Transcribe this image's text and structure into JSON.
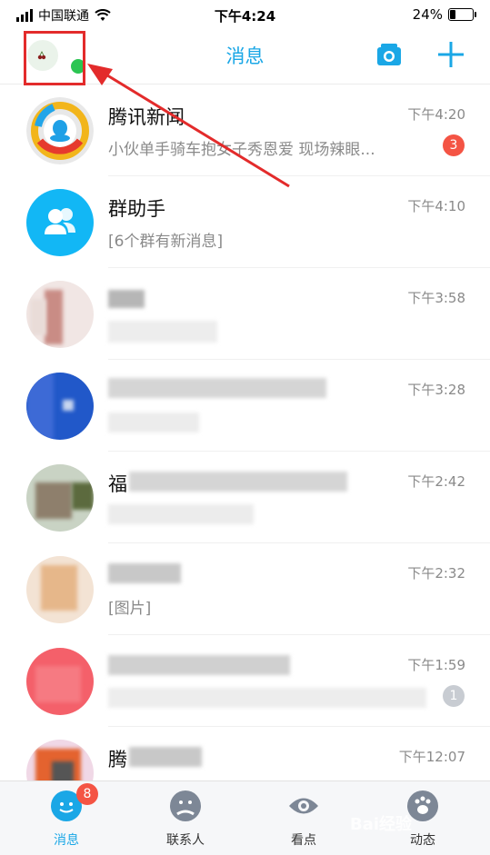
{
  "status_bar": {
    "carrier": "中国联通",
    "time": "下午4:24",
    "battery": "24%",
    "battery_level": 0.24
  },
  "header": {
    "title": "消息"
  },
  "chats": [
    {
      "name": "腾讯新闻",
      "message": "小伙单手骑车抱女子秀恩爱 现场辣眼...",
      "time": "下午4:20",
      "badge": "3"
    },
    {
      "name": "群助手",
      "message": "[6个群有新消息]",
      "time": "下午4:10",
      "badge": ""
    },
    {
      "name": "",
      "message": "",
      "time": "下午3:58",
      "badge": ""
    },
    {
      "name": "",
      "message": "",
      "time": "下午3:28",
      "badge": ""
    },
    {
      "name": "福",
      "message": "",
      "time": "下午2:42",
      "badge": ""
    },
    {
      "name": "",
      "message": "[图片]",
      "time": "下午2:32",
      "badge": ""
    },
    {
      "name": "",
      "message": "",
      "time": "下午1:59",
      "badge": "1"
    },
    {
      "name": "腾",
      "message": "",
      "time": "下午12:07",
      "badge": ""
    }
  ],
  "tabbar": {
    "tabs": [
      {
        "label": "消息",
        "badge": "8"
      },
      {
        "label": "联系人"
      },
      {
        "label": "看点"
      },
      {
        "label": "动态"
      }
    ]
  },
  "watermark": "Bai经验",
  "colors": {
    "accent": "#1aa7e6",
    "badge": "#f45444",
    "online": "#2bc552",
    "annotation": "#e32b2b"
  }
}
